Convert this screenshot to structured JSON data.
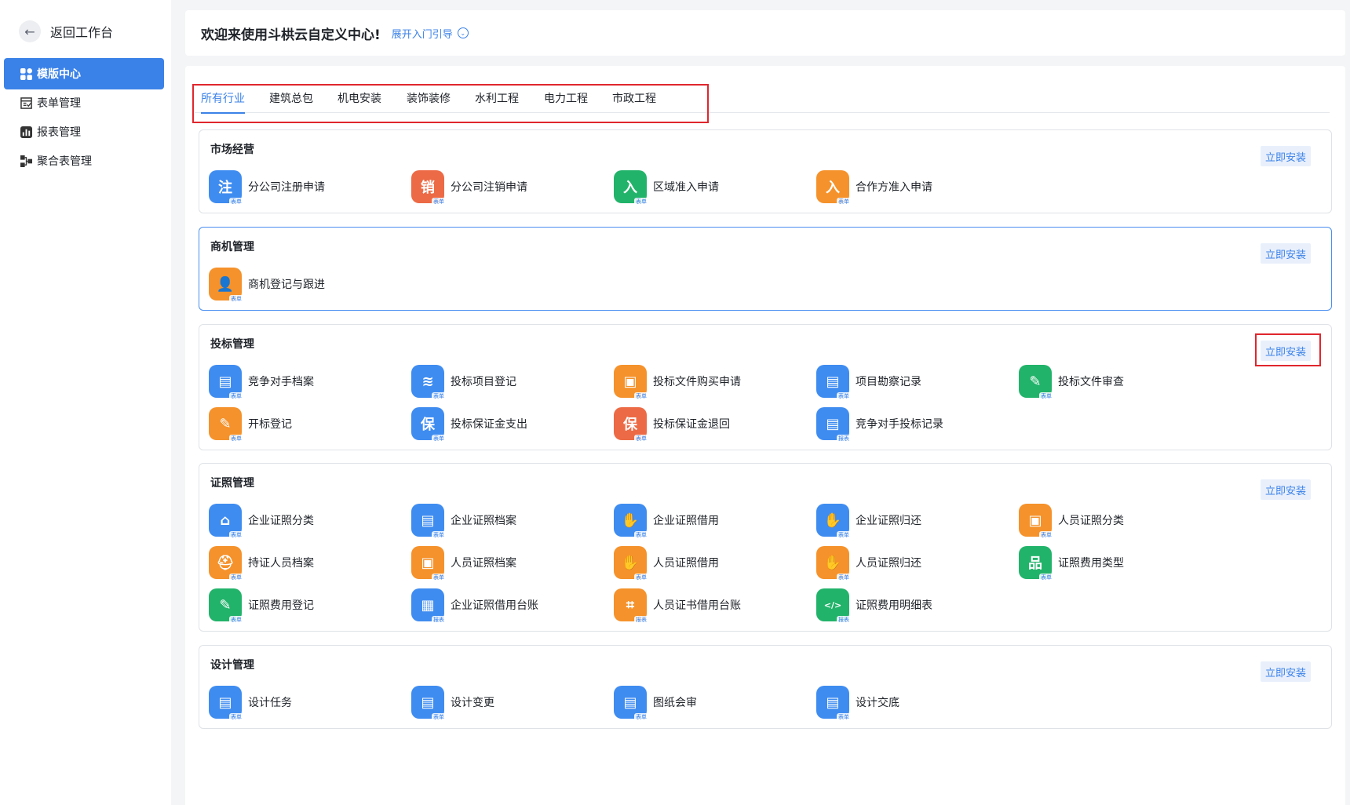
{
  "sidebar": {
    "back_label": "返回工作台",
    "items": [
      {
        "label": "模版中心",
        "icon": "grid-icon",
        "active": true
      },
      {
        "label": "表单管理",
        "icon": "form-icon"
      },
      {
        "label": "报表管理",
        "icon": "chart-icon"
      },
      {
        "label": "聚合表管理",
        "icon": "aggregate-icon"
      }
    ]
  },
  "header": {
    "welcome": "欢迎来使用斗栱云自定义中心!",
    "guide_label": "展开入门引导"
  },
  "tabs": [
    "所有行业",
    "建筑总包",
    "机电安装",
    "装饰装修",
    "水利工程",
    "电力工程",
    "市政工程"
  ],
  "install_label": "立即安装",
  "sections": [
    {
      "title": "市场经营",
      "items": [
        {
          "label": "分公司注册申请",
          "color": "#3f8cf0",
          "glyph": "注",
          "tag": "表单"
        },
        {
          "label": "分公司注销申请",
          "color": "#ec6a45",
          "glyph": "销",
          "tag": "表单"
        },
        {
          "label": "区域准入申请",
          "color": "#22b36a",
          "glyph": "入",
          "tag": "表单"
        },
        {
          "label": "合作方准入申请",
          "color": "#f5922b",
          "glyph": "入",
          "tag": "表单"
        }
      ]
    },
    {
      "title": "商机管理",
      "items": [
        {
          "label": "商机登记与跟进",
          "color": "#f5922b",
          "glyph": "👤",
          "tag": "表单"
        }
      ]
    },
    {
      "title": "投标管理",
      "items": [
        {
          "label": "竞争对手档案",
          "color": "#3f8cf0",
          "glyph": "▤",
          "tag": "表单"
        },
        {
          "label": "投标项目登记",
          "color": "#3f8cf0",
          "glyph": "≋",
          "tag": "表单"
        },
        {
          "label": "投标文件购买申请",
          "color": "#f5922b",
          "glyph": "▣",
          "tag": "表单"
        },
        {
          "label": "项目勘察记录",
          "color": "#3f8cf0",
          "glyph": "▤",
          "tag": "表单"
        },
        {
          "label": "投标文件审查",
          "color": "#22b36a",
          "glyph": "✎",
          "tag": "表单"
        },
        {
          "label": "开标登记",
          "color": "#f5922b",
          "glyph": "✎",
          "tag": "表单"
        },
        {
          "label": "投标保证金支出",
          "color": "#3f8cf0",
          "glyph": "保",
          "tag": "表单"
        },
        {
          "label": "投标保证金退回",
          "color": "#ec6a45",
          "glyph": "保",
          "tag": "表单"
        },
        {
          "label": "竞争对手投标记录",
          "color": "#3f8cf0",
          "glyph": "▤",
          "tag": "报表"
        }
      ]
    },
    {
      "title": "证照管理",
      "items": [
        {
          "label": "企业证照分类",
          "color": "#3f8cf0",
          "glyph": "⌂",
          "tag": "表单"
        },
        {
          "label": "企业证照档案",
          "color": "#3f8cf0",
          "glyph": "▤",
          "tag": "表单"
        },
        {
          "label": "企业证照借用",
          "color": "#3f8cf0",
          "glyph": "✋",
          "tag": "表单"
        },
        {
          "label": "企业证照归还",
          "color": "#3f8cf0",
          "glyph": "✋",
          "tag": "表单"
        },
        {
          "label": "人员证照分类",
          "color": "#f5922b",
          "glyph": "▣",
          "tag": "表单"
        },
        {
          "label": "持证人员档案",
          "color": "#f5922b",
          "glyph": "⛑",
          "tag": "表单"
        },
        {
          "label": "人员证照档案",
          "color": "#f5922b",
          "glyph": "▣",
          "tag": "表单"
        },
        {
          "label": "人员证照借用",
          "color": "#f5922b",
          "glyph": "✋",
          "tag": "表单"
        },
        {
          "label": "人员证照归还",
          "color": "#f5922b",
          "glyph": "✋",
          "tag": "表单"
        },
        {
          "label": "证照费用类型",
          "color": "#22b36a",
          "glyph": "品",
          "tag": "表单"
        },
        {
          "label": "证照费用登记",
          "color": "#22b36a",
          "glyph": "✎",
          "tag": "表单"
        },
        {
          "label": "企业证照借用台账",
          "color": "#3f8cf0",
          "glyph": "▦",
          "tag": "报表"
        },
        {
          "label": "人员证书借用台账",
          "color": "#f5922b",
          "glyph": "⌗",
          "tag": "报表"
        },
        {
          "label": "证照费用明细表",
          "color": "#22b36a",
          "glyph": "</>",
          "tag": "报表"
        }
      ]
    },
    {
      "title": "设计管理",
      "items": [
        {
          "label": "设计任务",
          "color": "#3f8cf0",
          "glyph": "▤",
          "tag": "表单"
        },
        {
          "label": "设计变更",
          "color": "#3f8cf0",
          "glyph": "▤",
          "tag": "表单"
        },
        {
          "label": "图纸会审",
          "color": "#3f8cf0",
          "glyph": "▤",
          "tag": "表单"
        },
        {
          "label": "设计交底",
          "color": "#3f8cf0",
          "glyph": "▤",
          "tag": "表单"
        }
      ]
    }
  ]
}
